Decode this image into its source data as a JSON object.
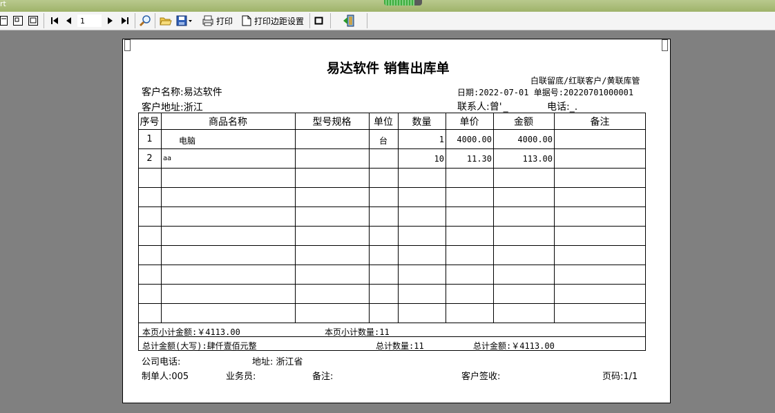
{
  "window": {
    "title_fragment": "rt"
  },
  "toolbar": {
    "page_value": "1",
    "print_label": "打印",
    "margin_label": "打印边距设置",
    "icons": [
      "page-icon",
      "page-icon",
      "page-icon",
      "first-page-icon",
      "prev-page-icon",
      "next-page-icon",
      "last-page-icon",
      "zoom-icon",
      "open-folder-icon",
      "save-icon",
      "print-icon",
      "page-setup-icon",
      "frame-icon",
      "exit-icon"
    ]
  },
  "report": {
    "title": "易达软件  销售出库单",
    "copy_note": "白联留底/红联客户/黄联库管",
    "customer_name": "客户名称:易达软件",
    "customer_address": "客户地址:浙江",
    "date_docno": "日期:2022-07-01 单据号:20220701000001",
    "contact": "联系人:曾'",
    "contact_redacted": "_",
    "phone": "电话:",
    "phone_redacted": "_.",
    "columns": [
      "序号",
      "商品名称",
      "型号规格",
      "单位",
      "数量",
      "单价",
      "金额",
      "备注"
    ],
    "rows": [
      {
        "no": "1",
        "name": "电脑",
        "spec": "",
        "unit": "台",
        "qty": "1",
        "price": "4000.00",
        "amount": "4000.00",
        "note": ""
      },
      {
        "no": "2",
        "name": "aa",
        "spec": "",
        "unit": "",
        "qty": "10",
        "price": "11.30",
        "amount": "113.00",
        "note": ""
      }
    ],
    "subtotal_amount": "本页小计金额:￥4113.00",
    "subtotal_qty": "本页小计数量:11",
    "total_words": "总计金额(大写):肆仟壹佰元整",
    "total_qty": "总计数量:11",
    "total_amount": "总计金额:￥4113.00",
    "company_phone": "公司电话:",
    "address": "地址: 浙江省",
    "maker": "制单人:005",
    "salesman": "业务员:",
    "remark": "备注:",
    "customer_sign": "客户签收:",
    "page_no": "页码:1/1"
  },
  "colors": {
    "background": "#808080",
    "paper": "#ffffff",
    "titlebar": "#a6b874",
    "toolbar": "#f4f4f4"
  }
}
